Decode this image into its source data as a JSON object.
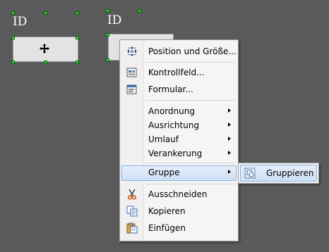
{
  "canvas": {
    "control1_label": "ID",
    "control2_label": "ID"
  },
  "context_menu": {
    "items": [
      {
        "label": "Position und Größe...",
        "icon": "position-size-icon"
      },
      {
        "label": "Kontrollfeld...",
        "icon": "control-properties-icon"
      },
      {
        "label": "Formular...",
        "icon": "form-properties-icon"
      },
      {
        "label": "Anordnung",
        "submenu": true
      },
      {
        "label": "Ausrichtung",
        "submenu": true
      },
      {
        "label": "Umlauf",
        "submenu": true
      },
      {
        "label": "Verankerung",
        "submenu": true
      },
      {
        "label": "Gruppe",
        "submenu": true,
        "highlighted": true
      },
      {
        "label": "Ausschneiden",
        "icon": "cut-icon"
      },
      {
        "label": "Kopieren",
        "icon": "copy-icon"
      },
      {
        "label": "Einfügen",
        "icon": "paste-icon"
      }
    ]
  },
  "submenu": {
    "items": [
      {
        "label": "Gruppieren",
        "icon": "group-icon",
        "highlighted": true
      }
    ]
  }
}
